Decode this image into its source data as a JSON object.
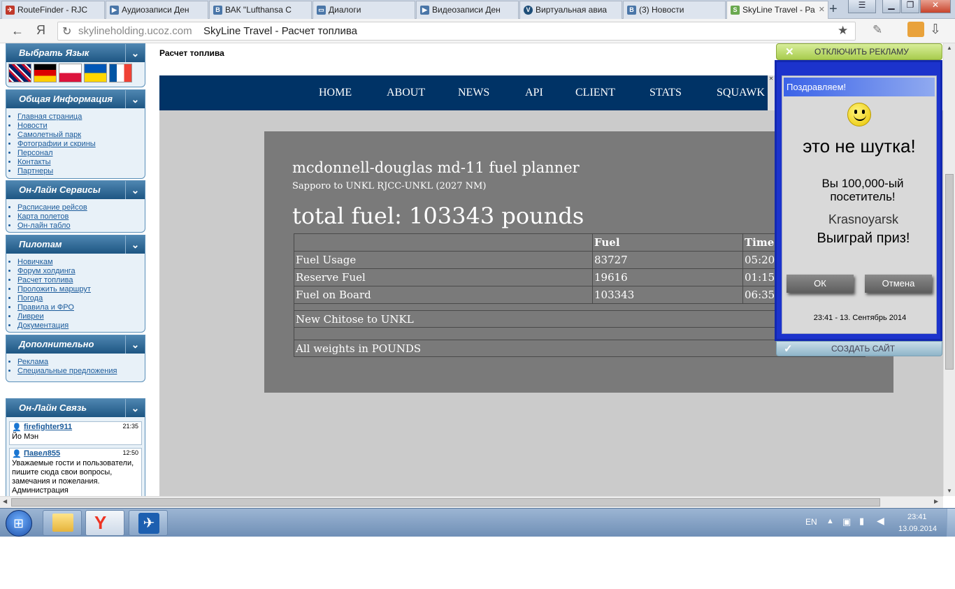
{
  "browser": {
    "tabs": [
      {
        "label": "RouteFinder - RJC",
        "icon_color": "#c0392b"
      },
      {
        "label": "Аудиозаписи Ден",
        "icon_color": "#4a76a8"
      },
      {
        "label": "ВАК \"Lufthansa C",
        "icon_color": "#4a76a8"
      },
      {
        "label": "Диалоги",
        "icon_color": "#4a76a8"
      },
      {
        "label": "Видеозаписи Ден",
        "icon_color": "#4a76a8"
      },
      {
        "label": "Виртуальная авиа",
        "icon_color": "#1e4e79"
      },
      {
        "label": "(3) Новости",
        "icon_color": "#4a76a8"
      },
      {
        "label": "SkyLine Travel - Ра",
        "icon_color": "#6aa84f"
      }
    ],
    "url_domain": "skylineholding.ucoz.com",
    "page_title": "SkyLine Travel - Расчет топлива",
    "yandex_letter": "Я"
  },
  "sidebar": {
    "language_title": "Выбрать Язык",
    "sections": [
      {
        "title": "Общая Информация",
        "items": [
          "Главная страница",
          "Новости",
          "Самолетный парк",
          "Фотографии и скрины",
          "Персонал",
          "Контакты",
          "Партнеры"
        ]
      },
      {
        "title": "Он-Лайн Сервисы",
        "items": [
          "Расписание рейсов",
          "Карта полетов",
          "Он-лайн табло"
        ]
      },
      {
        "title": "Пилотам",
        "items": [
          "Новичкам",
          "Форум холдинга",
          "Расчет топлива",
          "Проложить маршрут",
          "Погода",
          "Правила и ФРО",
          "Ливреи",
          "Документация"
        ]
      },
      {
        "title": "Дополнительно",
        "items": [
          "Реклама",
          "Специальные предложения"
        ]
      }
    ],
    "chat": {
      "title": "Он-Лайн Связь",
      "messages": [
        {
          "user": "firefighter911",
          "time": "21:35",
          "text": "Йо Мэн"
        },
        {
          "user": "Павел855",
          "time": "12:50",
          "text": "Уважаемые гости и пользователи, пишите сюда свои вопросы, замечания и пожелания. Администрация"
        }
      ]
    }
  },
  "main": {
    "page_heading": "Расчет топлива",
    "nav": [
      "HOME",
      "ABOUT",
      "NEWS",
      "API",
      "CLIENT",
      "STATS",
      "SQUAWK"
    ],
    "planner_title": "mcdonnell-douglas md-11 fuel planner",
    "route": "Sapporo to UNKL RJCC-UNKL (2027 NM)",
    "total_fuel": "total fuel: 103343 pounds",
    "table": {
      "headers": [
        "",
        "Fuel",
        "Time"
      ],
      "rows": [
        [
          "Fuel Usage",
          "83727",
          "05:20"
        ],
        [
          "Reserve Fuel",
          "19616",
          "01:15"
        ],
        [
          "Fuel on Board",
          "103343",
          "06:35"
        ]
      ],
      "note1": "New Chitose to UNKL",
      "note2": "All weights in POUNDS"
    }
  },
  "ad": {
    "disable_label": "ОТКЛЮЧИТЬ РЕКЛАМУ",
    "title": "Поздравляем!",
    "headline": "это не шутка!",
    "visitor": "Вы 100,000-ый посетитель!",
    "city": "Krasnoyarsk",
    "prize": "Выиграй приз!",
    "ok": "ОК",
    "cancel": "Отмена",
    "datetime": "23:41 - 13. Сентябрь 2014",
    "create_site": "СОЗДАТЬ САЙТ"
  },
  "taskbar": {
    "lang": "EN",
    "time": "23:41",
    "date": "13.09.2014"
  }
}
